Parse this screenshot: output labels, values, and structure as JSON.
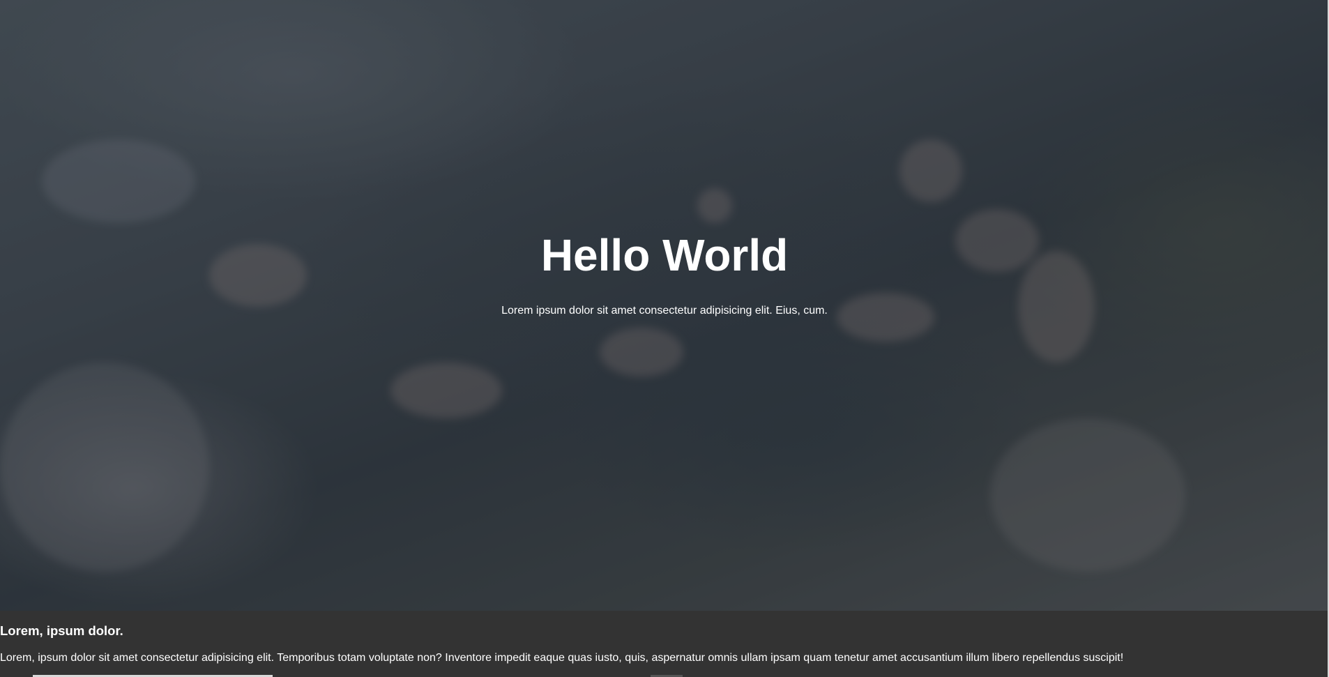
{
  "hero": {
    "title": "Hello World",
    "subtitle": "Lorem ipsum dolor sit amet consectetur adipisicing elit. Eius, cum."
  },
  "section": {
    "heading": "Lorem, ipsum dolor.",
    "text": "Lorem, ipsum dolor sit amet consectetur adipisicing elit. Temporibus totam voluptate non? Inventore impedit eaque quas iusto, quis, aspernatur omnis ullam ipsam quam tenetur amet accusantium illum libero repellendus suscipit!"
  },
  "colors": {
    "text": "#ffffff",
    "section_background": "#333333"
  }
}
